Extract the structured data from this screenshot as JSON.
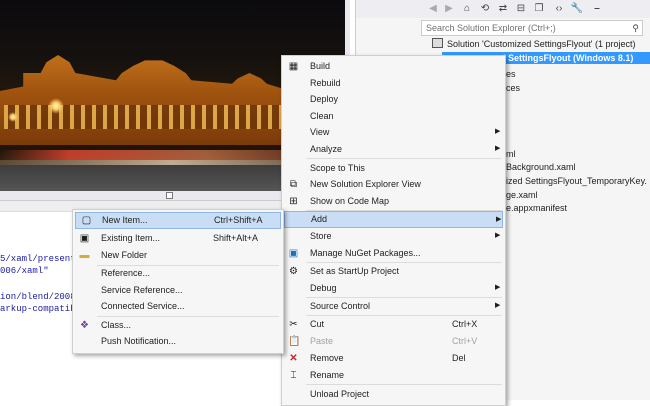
{
  "colors": {
    "selection": "#3399ff",
    "menu_highlight": "#c9def5",
    "menu_bg": "#f6f6f6",
    "disabled": "#a2a2a2",
    "code_blue": "#1a1aa6"
  },
  "editor": {
    "code_lines": [
      "5/xaml/present",
      "006/xaml\"",
      "ion/blend/2008",
      "arkup-compatib"
    ]
  },
  "solution_explorer": {
    "search_placeholder": "Search Solution Explorer (Ctrl+;)",
    "toolbar_icons": [
      "back-icon",
      "forward-icon",
      "home-icon",
      "history-icon",
      "sync-icon",
      "collapse-icon",
      "copy-icon",
      "code-icon",
      "properties-icon",
      "pin-icon"
    ],
    "tree": [
      "Solution 'Customized SettingsFlyout' (1 project)",
      "d SettingsFlyout (Windows 8.1)",
      "es",
      "ces",
      "ml",
      "Background.xaml",
      "ized SettingsFlyout_TemporaryKey.",
      "ge.xaml",
      "e.appxmanifest"
    ]
  },
  "context_menu": {
    "items": [
      {
        "label": "Build",
        "icon": "build-icon"
      },
      {
        "label": "Rebuild"
      },
      {
        "label": "Deploy"
      },
      {
        "label": "Clean"
      },
      {
        "label": "View",
        "submenu": true
      },
      {
        "label": "Analyze",
        "submenu": true
      },
      {
        "label": "Scope to This"
      },
      {
        "label": "New Solution Explorer View",
        "icon": "new-view-icon"
      },
      {
        "label": "Show on Code Map",
        "icon": "code-map-icon"
      },
      {
        "label": "Add",
        "submenu": true,
        "highlighted": true
      },
      {
        "label": "Store",
        "submenu": true
      },
      {
        "label": "Manage NuGet Packages...",
        "icon": "nuget-icon"
      },
      {
        "label": "Set as StartUp Project",
        "icon": "gear-icon"
      },
      {
        "label": "Debug",
        "submenu": true
      },
      {
        "label": "Source Control",
        "submenu": true
      },
      {
        "label": "Cut",
        "shortcut": "Ctrl+X",
        "icon": "scissors-icon"
      },
      {
        "label": "Paste",
        "shortcut": "Ctrl+V",
        "disabled": true,
        "icon": "paste-icon"
      },
      {
        "label": "Remove",
        "shortcut": "Del",
        "icon": "remove-icon"
      },
      {
        "label": "Rename",
        "icon": "rename-icon"
      },
      {
        "label": "Unload Project"
      }
    ]
  },
  "add_submenu": {
    "items": [
      {
        "label": "New Item...",
        "shortcut": "Ctrl+Shift+A",
        "highlighted": true,
        "icon": "new-item-icon"
      },
      {
        "label": "Existing Item...",
        "shortcut": "Shift+Alt+A",
        "icon": "existing-item-icon"
      },
      {
        "label": "New Folder",
        "icon": "folder-icon"
      },
      {
        "label": "Reference..."
      },
      {
        "label": "Service Reference..."
      },
      {
        "label": "Connected Service..."
      },
      {
        "label": "Class...",
        "icon": "class-icon"
      },
      {
        "label": "Push Notification..."
      }
    ]
  }
}
